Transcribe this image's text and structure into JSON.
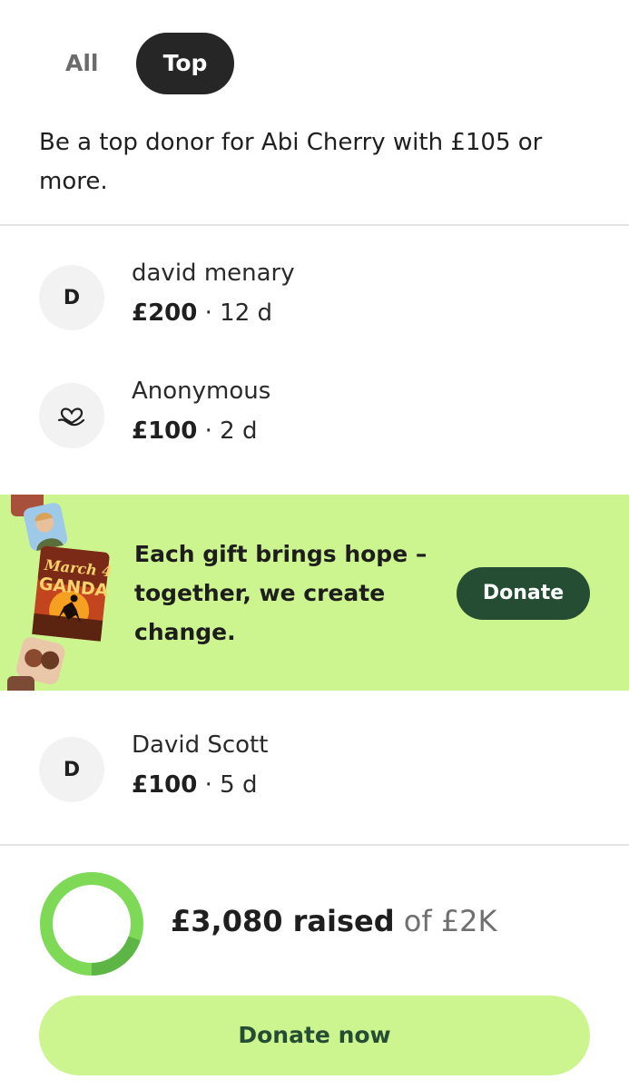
{
  "tabs": {
    "all_label": "All",
    "top_label": "Top",
    "selected": "Top"
  },
  "subtitle": "Be a top donor for Abi Cherry with £105 or more.",
  "donors": [
    {
      "initial": "D",
      "icon": null,
      "name": "david menary",
      "amount": "£200",
      "time": "12 d"
    },
    {
      "initial": "",
      "icon": "heart-hand-icon",
      "name": "Anonymous",
      "amount": "£100",
      "time": "2 d"
    },
    {
      "initial": "D",
      "icon": null,
      "name": "David Scott",
      "amount": "£100",
      "time": "5 d"
    }
  ],
  "separator": "·",
  "banner": {
    "text": "Each gift brings hope – together, we create change.",
    "button_label": "Donate",
    "poster_text_top": "March 4",
    "poster_text_bottom": "GANDA",
    "colors": {
      "background": "#cdf58f",
      "button": "#244d34"
    }
  },
  "summary": {
    "raised_amount": "£3,080 raised",
    "target_text": "of £2K",
    "progress_fraction": 1.0
  },
  "cta": {
    "label": "Donate now"
  },
  "colors": {
    "accent": "#cdf58f",
    "dark_green": "#244d34",
    "progress_green": "#7ed957"
  }
}
